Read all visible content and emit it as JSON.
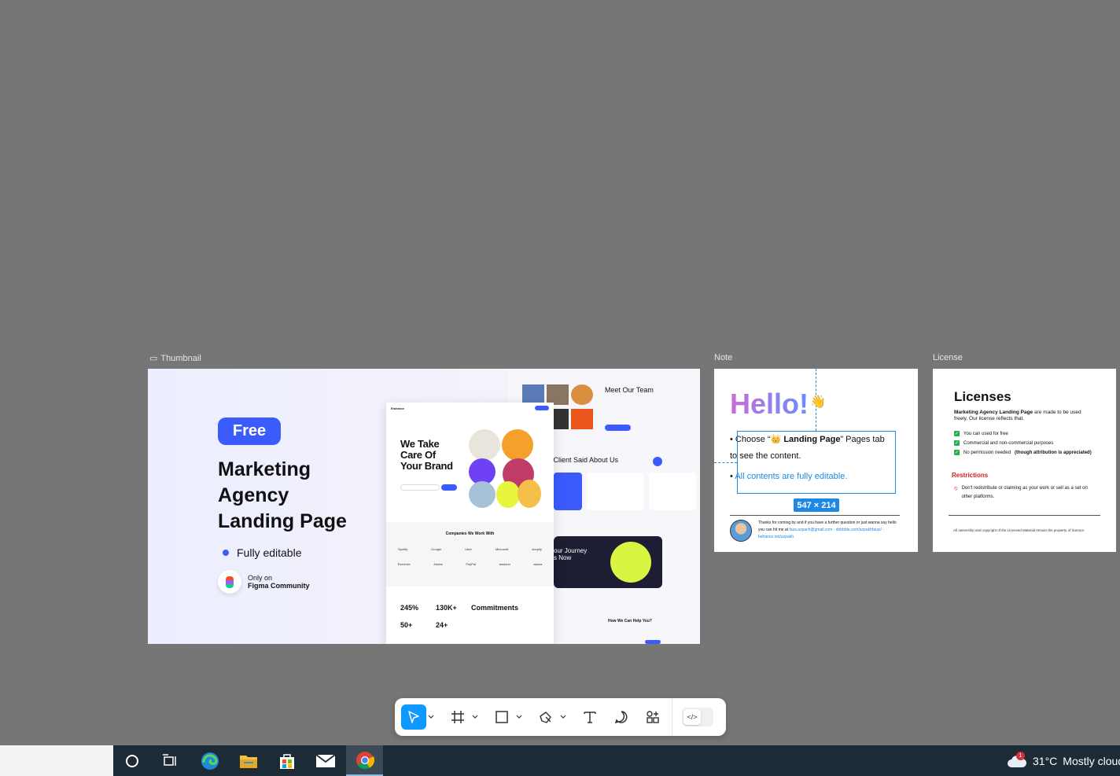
{
  "canvas": {
    "frames": [
      {
        "label": "Thumbnail"
      },
      {
        "label": "Note"
      },
      {
        "label": "License"
      }
    ]
  },
  "thumbnail": {
    "badge": "Free",
    "title": "Marketing\nAgency\nLanding Page",
    "feature": "Fully editable",
    "community_line1": "Only on",
    "community_line2": "Figma Community",
    "mock": {
      "brand": "Embrace",
      "headline": "We Take\nCare Of\nYour Brand",
      "companies_title": "Companies We Work With",
      "companies": [
        "Spotify",
        "Google",
        "Uber",
        "Microsoft",
        "shopify",
        "Evernote",
        "Adobe",
        "PayPal",
        "amazon",
        "asana"
      ],
      "stats": [
        "245%",
        "130K+",
        "50+",
        "24+"
      ],
      "commitments": "Commitments",
      "team_title": "Meet Our Team",
      "client_title": "r Client Said About Us",
      "journey": "our Journey\ns Now",
      "help": "How We Can Help You?"
    }
  },
  "note": {
    "hello": "Hello!",
    "wave": "👋",
    "item1_pre": "Choose “",
    "item1_bold": "👑 Landing Page",
    "item1_post": "” Pages tab to see the content.",
    "item2": "All contents are fully editable.",
    "selection_size": "547 × 214",
    "footer_text": "Thanks for coming by and if you have a further question or just wanna say hello you can hit me at",
    "footer_email": "faza.azpach@gmail.com",
    "footer_link1": "dribbble.com/azpakhfauzi/",
    "footer_link2": "behance.net/azpakh"
  },
  "license": {
    "title": "Licenses",
    "subtitle_bold": "Marketing Agency Landing Page",
    "subtitle_rest": " are made to be used freely. Our license reflects that.",
    "items": [
      "You can used for free",
      "Commercial and non-commercial purposes",
      "No permission needed"
    ],
    "item3_bold": "(though attribution is appreciated)",
    "restrictions_title": "Restrictions",
    "restriction": "Don't redistribute or claiming as your work or sell as a set on other platforms.",
    "footer": "All ownership and copyright of the Licensed Material remain the property of licensor."
  },
  "toolbar": {
    "tools": [
      "move-tool",
      "frame-tool",
      "shape-tool",
      "pen-tool",
      "text-tool",
      "comment-tool",
      "actions-tool"
    ],
    "active": "move-tool",
    "dev_mode_icon": "</>"
  },
  "taskbar": {
    "apps": [
      "cortana",
      "task-view",
      "edge",
      "file-explorer",
      "microsoft-store",
      "mail",
      "chrome"
    ],
    "active": "chrome",
    "weather_badge": "1",
    "temperature": "31°C",
    "weather_text": "Mostly cloudy"
  },
  "colors": {
    "canvas": "#767676",
    "accent": "#3b5bfd",
    "selection": "#1e88e5",
    "figma_blue": "#0d99ff"
  }
}
